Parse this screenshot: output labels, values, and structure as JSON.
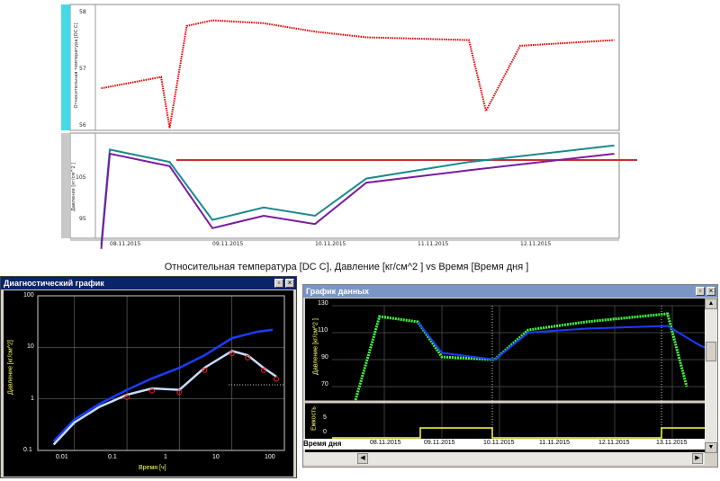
{
  "top_chart": {
    "caption": "Относительная температура [DC C], Давление [кг/см^2 ] vs Время  [Время дня ]",
    "temp_axis_label": "Относительная температура [DC C]",
    "pressure_axis_label": "Давление [кг/см^2 ]",
    "temp_ticks": [
      "58",
      "57",
      "56"
    ],
    "pressure_ticks": [
      "105",
      "95"
    ],
    "date_ticks": [
      "08.11.2015",
      "09.11.2015",
      "10.11.2015",
      "11.11.2015",
      "12.11.2015"
    ],
    "colors": {
      "temperature": "#e00000",
      "pressure_a": "#1a8a8a",
      "pressure_b": "#7a1aa0",
      "reference": "#c83030"
    }
  },
  "diag_window": {
    "title": "Диагностический график",
    "ylabel": "Давление [кг/см^2]",
    "xlabel": "Время   [ч]",
    "y_ticks": [
      "100",
      "10",
      "1",
      "0.1"
    ],
    "x_ticks": [
      "0.01",
      "0.1",
      "1",
      "10",
      "100"
    ],
    "title_bar_color": "#0a246a"
  },
  "data_window": {
    "title": "График данных",
    "ylabel": "Давление [кг/см^2 ]",
    "lower_ylabel": "Емкость",
    "xlabel": "Время дня",
    "y_ticks": [
      "130",
      "110",
      "90",
      "70"
    ],
    "lower_ticks": [
      "5",
      "0"
    ],
    "date_ticks": [
      "08.11.2015",
      "09.11.2015",
      "10.11.2015",
      "11.11.2015",
      "12.11.2015",
      "13.11.2015"
    ],
    "title_bar_color": "#7a96c4"
  },
  "chart_data": [
    {
      "type": "line",
      "title": "",
      "xlabel": "Время  [Время дня ]",
      "series": [
        {
          "name": "Относительная температура [DC C]",
          "x": [
            "07.11.2015 22:00",
            "08.11.2015 12:00",
            "08.11.2015 14:00",
            "08.11.2015 18:00",
            "09.11.2015 00:00",
            "09.11.2015 12:00",
            "10.11.2015 00:00",
            "10.11.2015 12:00",
            "11.11.2015 12:00",
            "11.11.2015 16:00",
            "12.11.2015 00:00",
            "12.11.2015 22:00"
          ],
          "y": [
            56.6,
            56.8,
            55.9,
            57.7,
            57.8,
            57.75,
            57.6,
            57.5,
            57.45,
            56.2,
            57.35,
            57.45
          ]
        },
        {
          "name": "Давление [кг/см^2 ] (1)",
          "x": [
            "07.11.2015 22:00",
            "08.11.2015 00:00",
            "08.11.2015 14:00",
            "09.11.2015 00:00",
            "09.11.2015 12:00",
            "10.11.2015 00:00",
            "10.11.2015 12:00",
            "11.11.2015 12:00",
            "12.11.2015 22:00"
          ],
          "y": [
            88,
            111,
            108,
            94,
            97,
            95,
            104,
            108,
            112
          ]
        },
        {
          "name": "Давление [кг/см^2 ] (2)",
          "x": [
            "07.11.2015 22:00",
            "08.11.2015 00:00",
            "08.11.2015 14:00",
            "09.11.2015 00:00",
            "09.11.2015 12:00",
            "10.11.2015 00:00",
            "10.11.2015 12:00",
            "11.11.2015 12:00",
            "12.11.2015 22:00"
          ],
          "y": [
            87,
            110,
            107,
            92,
            95,
            93,
            103,
            106,
            110
          ]
        }
      ]
    },
    {
      "type": "scatter",
      "title": "Диагностический график",
      "xlabel": "Время   [ч]",
      "ylabel": "Давление [кг/см^2]",
      "x_scale": "log",
      "y_scale": "log",
      "xlim": [
        0.002,
        100
      ],
      "ylim": [
        0.1,
        100
      ],
      "series": [
        {
          "x": [
            0.004,
            0.01,
            0.03,
            0.1,
            0.3,
            1,
            3,
            10,
            30,
            60
          ],
          "y": [
            0.15,
            0.4,
            0.8,
            1.5,
            2.5,
            4,
            7,
            15,
            20,
            22
          ]
        },
        {
          "x": [
            0.004,
            0.01,
            0.03,
            0.1,
            0.3,
            1,
            3,
            10,
            20,
            40,
            70
          ],
          "y": [
            0.13,
            0.35,
            0.7,
            1.2,
            1.6,
            1.5,
            4,
            8.5,
            7,
            4,
            2.7
          ]
        }
      ]
    },
    {
      "type": "scatter",
      "title": "График данных",
      "ylabel": "Давление [кг/см^2 ]",
      "xlabel": "Время дня",
      "ylim": [
        60,
        130
      ],
      "series": [
        {
          "x": [
            "07.11.2015 12:00",
            "07.11.2015 22:00",
            "08.11.2015 14:00",
            "09.11.2015 00:00",
            "09.11.2015 22:00",
            "10.11.2015 12:00",
            "11.11.2015 12:00",
            "12.11.2015 22:00",
            "13.11.2015 06:00"
          ],
          "y": [
            60,
            122,
            118,
            92,
            90,
            112,
            118,
            124,
            70
          ]
        },
        {
          "x": [
            "08.11.2015 14:00",
            "09.11.2015 00:00",
            "09.11.2015 22:00",
            "10.11.2015 12:00",
            "11.11.2015 12:00",
            "12.11.2015 22:00",
            "13.11.2015 12:00",
            "13.11.2015 22:00"
          ],
          "y": [
            118,
            95,
            90,
            110,
            113,
            115,
            100,
            94
          ]
        }
      ]
    }
  ]
}
